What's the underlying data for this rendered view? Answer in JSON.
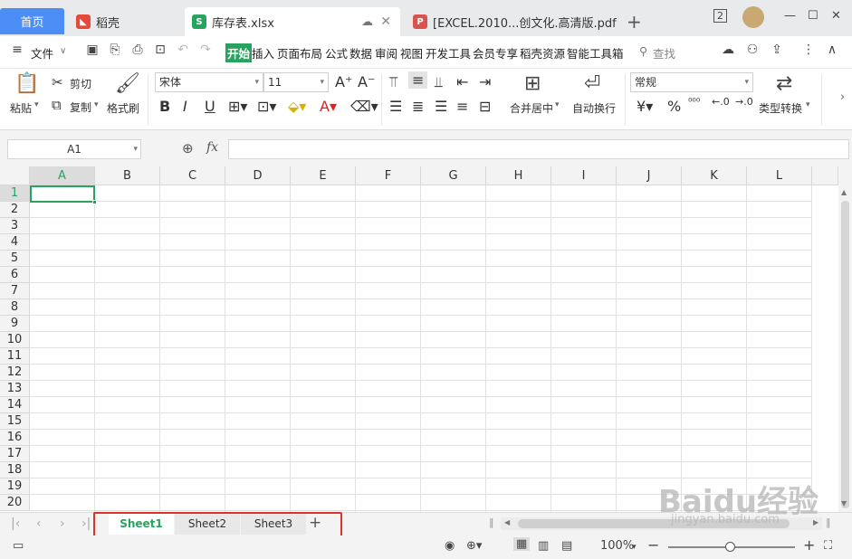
{
  "tabs": {
    "home": "首页",
    "daoke": "稻壳",
    "xlsx": "库存表.xlsx",
    "pdf": "[EXCEL.2010...创文化.高清版.pdf"
  },
  "window": {
    "badge": "2"
  },
  "menu": {
    "file": "文件",
    "items": [
      "开始",
      "插入",
      "页面布局",
      "公式",
      "数据",
      "审阅",
      "视图",
      "开发工具",
      "会员专享",
      "稻壳资源",
      "智能工具箱"
    ],
    "search": "查找"
  },
  "ribbon": {
    "paste": "粘贴",
    "cut": "剪切",
    "copy": "复制",
    "format_painter": "格式刷",
    "font_name": "宋体",
    "font_size": "11",
    "merge_center": "合并居中",
    "wrap_text": "自动换行",
    "number_format": "常规",
    "type_convert": "类型转换",
    "percent": "%",
    "currency": "¥"
  },
  "formula_bar": {
    "cell_ref": "A1",
    "fx": "fx",
    "value": ""
  },
  "grid": {
    "columns": [
      "A",
      "B",
      "C",
      "D",
      "E",
      "F",
      "G",
      "H",
      "I",
      "J",
      "K",
      "L"
    ],
    "rows": [
      "1",
      "2",
      "3",
      "4",
      "5",
      "6",
      "7",
      "8",
      "9",
      "10",
      "11",
      "12",
      "13",
      "14",
      "15",
      "16",
      "17",
      "18",
      "19",
      "20"
    ],
    "selected_cell": "A1"
  },
  "sheets": [
    "Sheet1",
    "Sheet2",
    "Sheet3"
  ],
  "active_sheet": "Sheet1",
  "status": {
    "zoom": "100%"
  },
  "watermark": {
    "logo": "Baidu经验",
    "url": "jingyan.baidu.com"
  },
  "colors": {
    "accent": "#27a35f",
    "home_tab": "#4c8df6",
    "highlight": "#e0302b"
  }
}
